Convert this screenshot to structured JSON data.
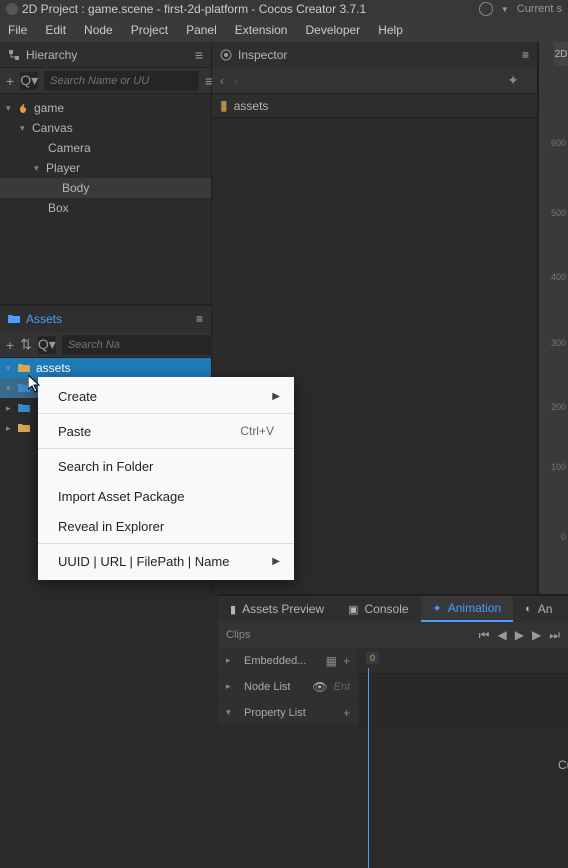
{
  "title": "2D Project : game.scene - first-2d-platform - Cocos Creator 3.7.1",
  "topRight": {
    "label": "Current s"
  },
  "menu": {
    "file": "File",
    "edit": "Edit",
    "node": "Node",
    "project": "Project",
    "panel": "Panel",
    "extension": "Extension",
    "developer": "Developer",
    "help": "Help"
  },
  "hierarchy": {
    "title": "Hierarchy",
    "searchPlaceholder": "Search Name or UU",
    "items": {
      "root": "game",
      "canvas": "Canvas",
      "camera": "Camera",
      "player": "Player",
      "body": "Body",
      "box": "Box"
    }
  },
  "assets": {
    "title": "Assets",
    "searchPlaceholder": "Search Na",
    "root": "assets"
  },
  "inspector": {
    "title": "Inspector",
    "breadcrumb": "assets"
  },
  "ruler": {
    "m600": "600",
    "m500": "500",
    "m400": "400",
    "m300": "300",
    "m200": "200",
    "m100": "100",
    "m0": "0",
    "label2d": "2D"
  },
  "contextMenu": {
    "create": "Create",
    "paste": "Paste",
    "pasteShortcut": "Ctrl+V",
    "search": "Search in Folder",
    "import": "Import Asset Package",
    "reveal": "Reveal in Explorer",
    "uuid": "UUID | URL | FilePath | Name"
  },
  "bottomTabs": {
    "assetsPreview": "Assets Preview",
    "console": "Console",
    "animation": "Animation",
    "an": "An"
  },
  "timeline": {
    "clips": "Clips",
    "embedded": "Embedded...",
    "nodeList": "Node List",
    "enter": "Ent",
    "propertyList": "Property List",
    "marker": "0",
    "message": "Current node does not have"
  }
}
